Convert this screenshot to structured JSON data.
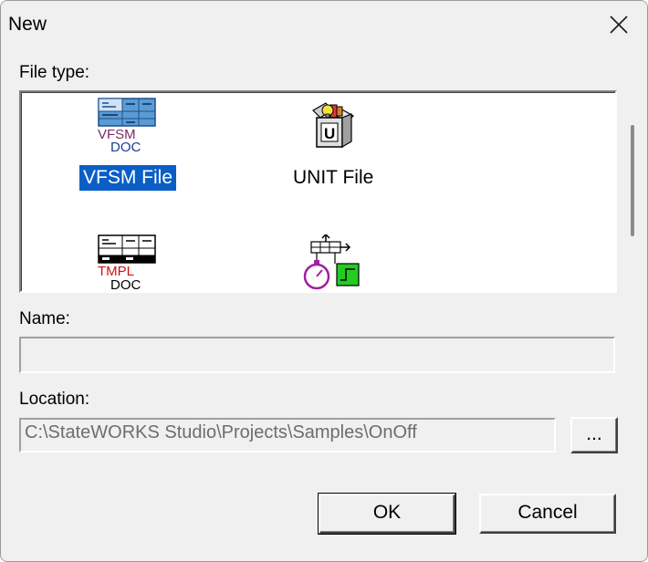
{
  "window": {
    "title": "New"
  },
  "labels": {
    "file_type": "File type:",
    "name": "Name:",
    "location": "Location:"
  },
  "file_types": [
    {
      "label": "VFSM File",
      "icon": "vfsm-doc-icon",
      "icon_text_top": "VFSM",
      "icon_text_bottom": "DOC",
      "selected": true
    },
    {
      "label": "UNIT File",
      "icon": "unit-package-icon",
      "icon_text_top": "U",
      "selected": false
    },
    {
      "label": "",
      "icon": "tmpl-doc-icon",
      "icon_text_top": "TMPL",
      "icon_text_bottom": "DOC",
      "selected": false
    },
    {
      "label": "",
      "icon": "timer-state-icon",
      "selected": false
    }
  ],
  "name_field": {
    "value": ""
  },
  "location_field": {
    "value": "C:\\StateWORKS Studio\\Projects\\Samples\\OnOff"
  },
  "buttons": {
    "browse": "...",
    "ok": "OK",
    "cancel": "Cancel"
  },
  "colors": {
    "selection": "#0a5ec6",
    "vfsm_text": "#7a2a6a",
    "doc_text": "#1c3c9c",
    "tmpl_text": "#d01010",
    "timer_green": "#22cc22",
    "timer_purple": "#a020a0"
  }
}
